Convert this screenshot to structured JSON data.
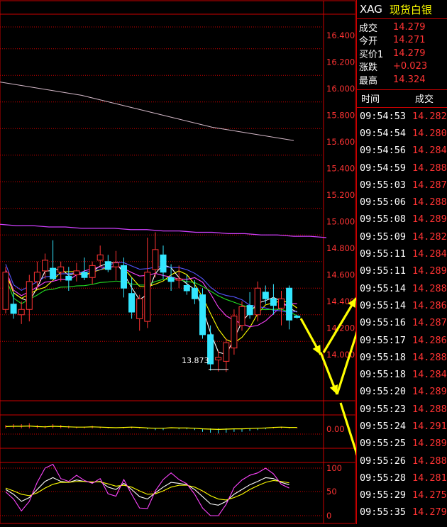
{
  "header": {
    "code": "XAG",
    "name": "现货白银"
  },
  "quote": [
    {
      "label": "成交",
      "value": "14.279"
    },
    {
      "label": "今开",
      "value": "14.271"
    },
    {
      "label": "买价1",
      "value": "14.279"
    },
    {
      "label": "涨跌",
      "value": "+0.023"
    },
    {
      "label": "最高",
      "value": "14.324"
    }
  ],
  "trades": {
    "header": {
      "time": "时间",
      "price": "成交"
    },
    "rows": [
      {
        "time": "09:54:53",
        "price": "14.282"
      },
      {
        "time": "09:54:54",
        "price": "14.280"
      },
      {
        "time": "09:54:56",
        "price": "14.284"
      },
      {
        "time": "09:54:59",
        "price": "14.288"
      },
      {
        "time": "09:55:03",
        "price": "14.287"
      },
      {
        "time": "09:55:06",
        "price": "14.288"
      },
      {
        "time": "09:55:08",
        "price": "14.289"
      },
      {
        "time": "09:55:09",
        "price": "14.282"
      },
      {
        "time": "09:55:11",
        "price": "14.284"
      },
      {
        "time": "09:55:11",
        "price": "14.289"
      },
      {
        "time": "09:55:14",
        "price": "14.288"
      },
      {
        "time": "09:55:14",
        "price": "14.286"
      },
      {
        "time": "09:55:16",
        "price": "14.287"
      },
      {
        "time": "09:55:17",
        "price": "14.286"
      },
      {
        "time": "09:55:18",
        "price": "14.288"
      },
      {
        "time": "09:55:18",
        "price": "14.284"
      },
      {
        "time": "09:55:20",
        "price": "14.289"
      },
      {
        "time": "09:55:23",
        "price": "14.288"
      },
      {
        "time": "09:55:24",
        "price": "14.291"
      },
      {
        "time": "09:55:25",
        "price": "14.289"
      },
      {
        "time": "09:55:26",
        "price": "14.288"
      },
      {
        "time": "09:55:28",
        "price": "14.281"
      },
      {
        "time": "09:55:29",
        "price": "14.275"
      },
      {
        "time": "09:55:35",
        "price": "14.279"
      }
    ]
  },
  "chart_data": {
    "type": "candlestick",
    "y_ticks": [
      "16.400",
      "16.200",
      "16.000",
      "15.800",
      "15.600",
      "15.400",
      "15.200",
      "15.000",
      "14.800",
      "14.600",
      "14.400",
      "14.200",
      "14.000"
    ],
    "ylim": [
      13.75,
      16.5
    ],
    "low_label": "13.873",
    "colors": {
      "up": "#ff3333",
      "down": "#33e6ff",
      "ma_white": "#ffffff",
      "ma_yellow": "#ffff00",
      "ma_pink": "#ff44ff",
      "ma_green": "#22dd22",
      "ma_blue": "#5555ff",
      "ma_slow": "#d4b8c8",
      "ma_magenta": "#d040ff",
      "arrow": "#ffff00"
    },
    "candles": [
      {
        "o": 14.34,
        "h": 14.66,
        "l": 14.31,
        "c": 14.62
      },
      {
        "o": 14.38,
        "h": 14.47,
        "l": 14.27,
        "c": 14.31
      },
      {
        "o": 14.3,
        "h": 14.4,
        "l": 14.23,
        "c": 14.34
      },
      {
        "o": 14.34,
        "h": 14.6,
        "l": 14.25,
        "c": 14.55
      },
      {
        "o": 14.55,
        "h": 14.7,
        "l": 14.5,
        "c": 14.62
      },
      {
        "o": 14.63,
        "h": 14.76,
        "l": 14.57,
        "c": 14.71
      },
      {
        "o": 14.65,
        "h": 14.86,
        "l": 14.6,
        "c": 14.57
      },
      {
        "o": 14.62,
        "h": 14.7,
        "l": 14.55,
        "c": 14.66
      },
      {
        "o": 14.59,
        "h": 14.66,
        "l": 14.48,
        "c": 14.56
      },
      {
        "o": 14.6,
        "h": 14.69,
        "l": 14.55,
        "c": 14.63
      },
      {
        "o": 14.62,
        "h": 14.73,
        "l": 14.56,
        "c": 14.58
      },
      {
        "o": 14.58,
        "h": 14.7,
        "l": 14.53,
        "c": 14.67
      },
      {
        "o": 14.71,
        "h": 14.82,
        "l": 14.66,
        "c": 14.75
      },
      {
        "o": 14.7,
        "h": 14.75,
        "l": 14.62,
        "c": 14.64
      },
      {
        "o": 14.66,
        "h": 14.78,
        "l": 14.56,
        "c": 14.69
      },
      {
        "o": 14.67,
        "h": 14.73,
        "l": 14.43,
        "c": 14.5
      },
      {
        "o": 14.46,
        "h": 14.58,
        "l": 14.27,
        "c": 14.32
      },
      {
        "o": 14.27,
        "h": 14.45,
        "l": 14.18,
        "c": 14.42
      },
      {
        "o": 14.25,
        "h": 14.88,
        "l": 14.2,
        "c": 14.62
      },
      {
        "o": 14.64,
        "h": 14.92,
        "l": 14.58,
        "c": 14.79
      },
      {
        "o": 14.75,
        "h": 14.82,
        "l": 14.57,
        "c": 14.62
      },
      {
        "o": 14.58,
        "h": 14.68,
        "l": 14.48,
        "c": 14.55
      },
      {
        "o": 14.56,
        "h": 14.67,
        "l": 14.5,
        "c": 14.57
      },
      {
        "o": 14.52,
        "h": 14.6,
        "l": 14.45,
        "c": 14.48
      },
      {
        "o": 14.5,
        "h": 14.56,
        "l": 14.38,
        "c": 14.42
      },
      {
        "o": 14.45,
        "h": 14.5,
        "l": 14.12,
        "c": 14.15
      },
      {
        "o": 14.15,
        "h": 14.22,
        "l": 13.88,
        "c": 13.93
      },
      {
        "o": 13.96,
        "h": 14.03,
        "l": 13.873,
        "c": 13.98
      },
      {
        "o": 13.95,
        "h": 14.12,
        "l": 13.87,
        "c": 14.09
      },
      {
        "o": 14.05,
        "h": 14.34,
        "l": 14.0,
        "c": 14.29
      },
      {
        "o": 14.22,
        "h": 14.4,
        "l": 14.18,
        "c": 14.36
      },
      {
        "o": 14.37,
        "h": 14.47,
        "l": 14.27,
        "c": 14.3
      },
      {
        "o": 14.3,
        "h": 14.55,
        "l": 14.25,
        "c": 14.5
      },
      {
        "o": 14.47,
        "h": 14.52,
        "l": 14.38,
        "c": 14.42
      },
      {
        "o": 14.42,
        "h": 14.53,
        "l": 14.3,
        "c": 14.37
      },
      {
        "o": 14.35,
        "h": 14.48,
        "l": 14.22,
        "c": 14.42
      },
      {
        "o": 14.5,
        "h": 14.52,
        "l": 14.19,
        "c": 14.26
      },
      {
        "o": 14.29,
        "h": 14.3,
        "l": 14.27,
        "c": 14.28
      }
    ],
    "ma_slow": [
      16.05,
      16.03,
      16.01,
      15.99,
      15.97,
      15.95,
      15.92,
      15.89,
      15.86,
      15.83,
      15.8,
      15.77,
      15.74,
      15.71,
      15.69,
      15.67,
      15.65,
      15.63,
      15.61
    ],
    "ma_magenta": [
      14.98,
      14.97,
      14.97,
      14.96,
      14.96,
      14.95,
      14.95,
      14.95,
      14.94,
      14.94,
      14.93,
      14.93,
      14.92,
      14.92,
      14.91,
      14.91,
      14.9,
      14.9,
      14.89,
      14.89,
      14.88
    ],
    "macd": {
      "label": "0.00",
      "hist": [
        0.04,
        0.05,
        0.05,
        0.06,
        0.04,
        0.03,
        0.05,
        0.04,
        0.03,
        0.02,
        0.02,
        0.03,
        0.02,
        0.01,
        0.0,
        0.01,
        0.02,
        0.01,
        -0.01,
        -0.02,
        -0.02,
        0.0,
        -0.01,
        -0.01,
        -0.02,
        -0.04,
        -0.05,
        -0.06,
        -0.05,
        -0.04,
        -0.04,
        -0.03,
        -0.02,
        -0.01,
        0.01,
        0.02,
        0.01,
        0.01
      ]
    },
    "kdj": {
      "ticks": [
        "100",
        "50",
        "0"
      ],
      "k": [
        55,
        45,
        30,
        38,
        55,
        72,
        80,
        72,
        70,
        75,
        72,
        70,
        72,
        60,
        55,
        68,
        55,
        40,
        35,
        48,
        60,
        70,
        68,
        65,
        55,
        40,
        25,
        22,
        30,
        45,
        55,
        65,
        72,
        80,
        78,
        70,
        65
      ],
      "d": [
        58,
        52,
        45,
        42,
        48,
        58,
        66,
        70,
        70,
        72,
        72,
        71,
        71,
        67,
        62,
        64,
        60,
        52,
        45,
        46,
        52,
        60,
        64,
        64,
        60,
        52,
        42,
        35,
        33,
        38,
        45,
        55,
        63,
        70,
        74,
        72,
        69
      ],
      "j": [
        50,
        35,
        10,
        30,
        70,
        100,
        108,
        78,
        72,
        85,
        74,
        68,
        78,
        46,
        41,
        76,
        45,
        16,
        15,
        52,
        76,
        90,
        76,
        67,
        45,
        16,
        0,
        0,
        24,
        59,
        75,
        85,
        90,
        100,
        88,
        66,
        58
      ]
    }
  }
}
